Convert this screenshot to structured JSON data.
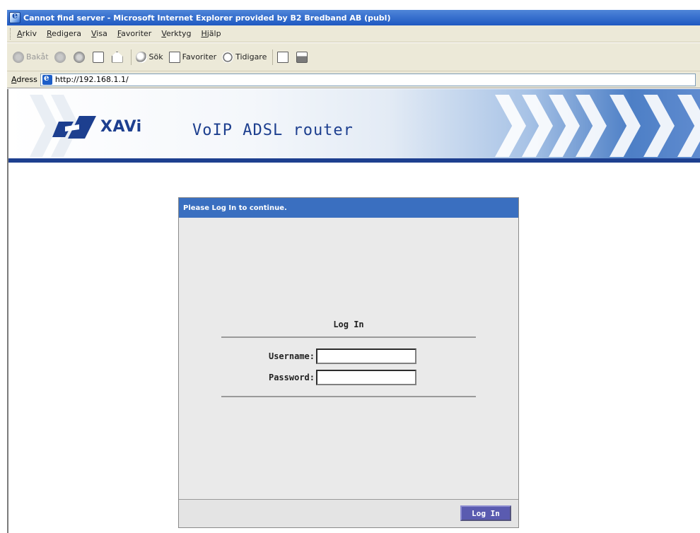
{
  "window": {
    "title": "Cannot find server - Microsoft Internet Explorer provided by B2 Bredband AB (publ)"
  },
  "menubar": {
    "items": [
      "Arkiv",
      "Redigera",
      "Visa",
      "Favoriter",
      "Verktyg",
      "Hjälp"
    ]
  },
  "toolbar": {
    "back_label": "Bakåt",
    "search_label": "Sök",
    "favorites_label": "Favoriter",
    "history_label": "Tidigare"
  },
  "addressbar": {
    "label": "Adress",
    "url": "http://192.168.1.1/"
  },
  "page": {
    "brand": "XAVi",
    "product": "VoIP ADSL router",
    "login_panel": {
      "header": "Please Log In to continue.",
      "title": "Log In",
      "username_label": "Username:",
      "password_label": "Password:",
      "username_value": "",
      "password_value": "",
      "submit_label": "Log In"
    }
  },
  "colors": {
    "brand_blue": "#1d3f8f",
    "panel_header": "#3a6fc0",
    "button": "#5a5bb0",
    "titlebar": "#1e58c1"
  }
}
